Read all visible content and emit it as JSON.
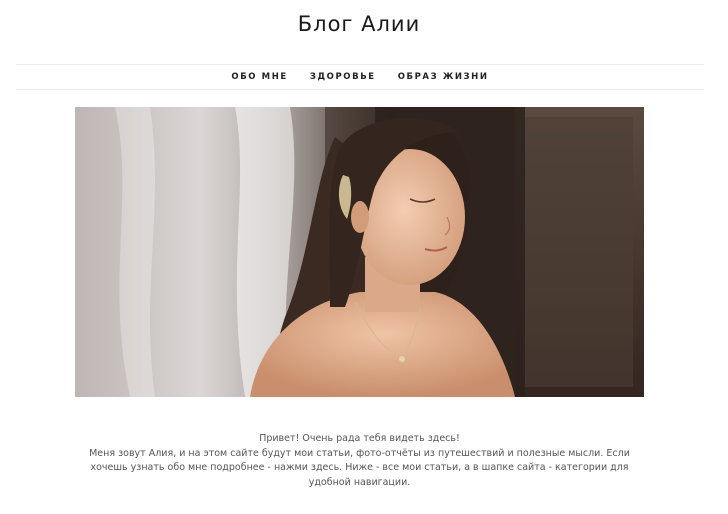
{
  "header": {
    "site_title": "Блог Алии"
  },
  "nav": {
    "items": [
      {
        "label": "ОБО МНЕ"
      },
      {
        "label": "ЗДОРОВЬЕ"
      },
      {
        "label": "ОБРАЗ ЖИЗНИ"
      }
    ]
  },
  "hero": {
    "image": "portrait-photo"
  },
  "intro": {
    "greeting": "Привет! Очень рада тебя видеть здесь!",
    "body": "Меня зовут Алия, и на этом сайте будут мои статьи, фото-отчёты из путешествий и полезные мысли. Если хочешь узнать обо мне подробнее - нажми здесь. Ниже - все мои статьи, а в шапке сайта - категории для удобной навигации."
  }
}
